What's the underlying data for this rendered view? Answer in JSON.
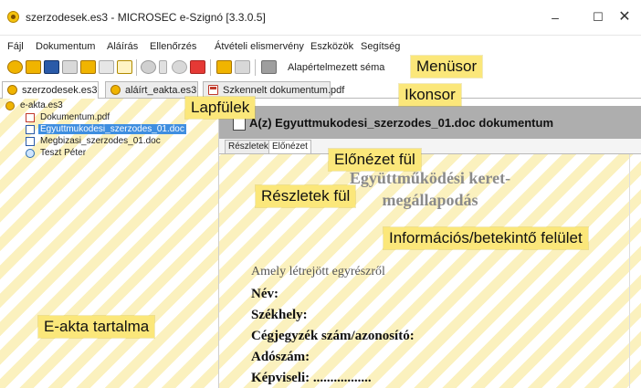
{
  "window": {
    "title": "szerzodesek.es3 - MICROSEC e-Szignó [3.3.0.5]",
    "minimize": "–",
    "maximize": "☐",
    "close": "✕"
  },
  "menu": {
    "items": [
      "Fájl",
      "Dokumentum",
      "Aláírás",
      "Ellenőrzés",
      "Átvételi elismervény",
      "Eszközök",
      "Segítség"
    ]
  },
  "toolbar": {
    "schema_label": "Alapértelmezett séma",
    "icons": [
      "open-folder-icon",
      "new-folder-icon",
      "save-icon",
      "sign-icon",
      "add-document-icon",
      "document-icon",
      "envelope-icon",
      "verify-icon",
      "star-icon",
      "check-icon",
      "folder-sign-icon",
      "edit-icon",
      "schema-icon"
    ]
  },
  "tabs": [
    {
      "label": "szerzodesek.es3",
      "icon": "eakta-icon",
      "active": true
    },
    {
      "label": "aláírt_eakta.es3",
      "icon": "eakta-icon",
      "active": false
    },
    {
      "label": "Szkennelt dokumentum.pdf",
      "icon": "pdf-icon",
      "active": false
    }
  ],
  "tree": {
    "root": "e-akta.es3",
    "children": [
      {
        "label": "Dokumentum.pdf",
        "icon": "pdf-icon",
        "selected": false
      },
      {
        "label": "Egyuttmukodesi_szerzodes_01.doc",
        "icon": "doc-icon",
        "selected": true
      },
      {
        "label": "Megbizasi_szerzodes_01.doc",
        "icon": "doc-icon",
        "selected": false
      },
      {
        "label": "Teszt Péter",
        "icon": "person-icon",
        "selected": false
      }
    ]
  },
  "detail": {
    "header": "A(z) Egyuttmukodesi_szerzodes_01.doc dokumentum",
    "subtabs": [
      "Részletek",
      "Előnézet"
    ]
  },
  "preview": {
    "title_line1": "Együttműködési keret-",
    "title_line2": "megállapodás",
    "intro": "Amely létrejött egyrészről",
    "fields": [
      "Név:",
      "Székhely:",
      "Cégjegyzék szám/azonosító:",
      "Adószám:",
      "Képviseli: ................."
    ]
  },
  "callouts": {
    "menusor": "Menüsor",
    "ikonsor": "Ikonsor",
    "lapfulek": "Lapfülek",
    "elonezet": "Előnézet fül",
    "reszletek": "Részletek fül",
    "info": "Információs/betekintő felület",
    "eakta": "E-akta tartalma"
  }
}
